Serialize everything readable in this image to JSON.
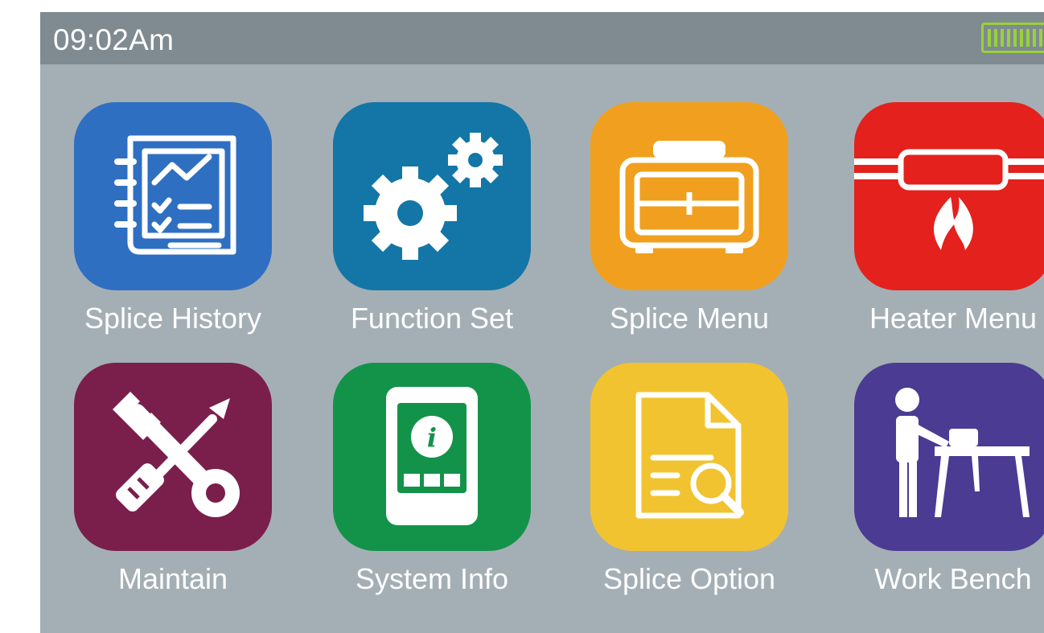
{
  "status_bar": {
    "time": "09:02Am",
    "battery_icon": "battery-full-icon",
    "battery_color": "#9ad13a"
  },
  "apps": [
    {
      "label": "Splice History",
      "icon": "splice-history-icon",
      "color": "#2f6fc2"
    },
    {
      "label": "Function Set",
      "icon": "gears-icon",
      "color": "#1376a6"
    },
    {
      "label": "Splice Menu",
      "icon": "splicer-machine-icon",
      "color": "#f0a01e"
    },
    {
      "label": "Heater Menu",
      "icon": "heater-flame-icon",
      "color": "#e4211c"
    },
    {
      "label": "Maintain",
      "icon": "wrench-screwdriver-icon",
      "color": "#7a1f4b"
    },
    {
      "label": "System Info",
      "icon": "device-info-icon",
      "color": "#13934a"
    },
    {
      "label": "Splice Option",
      "icon": "document-search-icon",
      "color": "#f2c330"
    },
    {
      "label": "Work Bench",
      "icon": "person-workbench-icon",
      "color": "#4b3b93"
    }
  ]
}
